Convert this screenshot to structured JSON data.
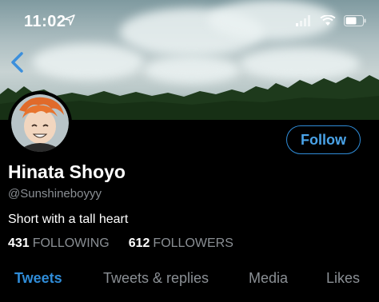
{
  "status_bar": {
    "time": "11:02"
  },
  "profile": {
    "name": "Hinata Shoyo",
    "handle": "@Sunshineboyyy",
    "bio": "Short with a tall heart",
    "following_count": "431",
    "following_label": "FOLLOWING",
    "followers_count": "612",
    "followers_label": "FOLLOWERS",
    "follow_button": "Follow"
  },
  "tabs": [
    "Tweets",
    "Tweets & replies",
    "Media",
    "Likes"
  ],
  "active_tab": "Tweets",
  "colors": {
    "accent": "#2f8cd8",
    "muted_text": "#8a8f94",
    "background": "#000000"
  },
  "icons": [
    "back-chevron-icon",
    "location-arrow-icon",
    "cellular-signal-icon",
    "wifi-icon",
    "battery-icon"
  ]
}
